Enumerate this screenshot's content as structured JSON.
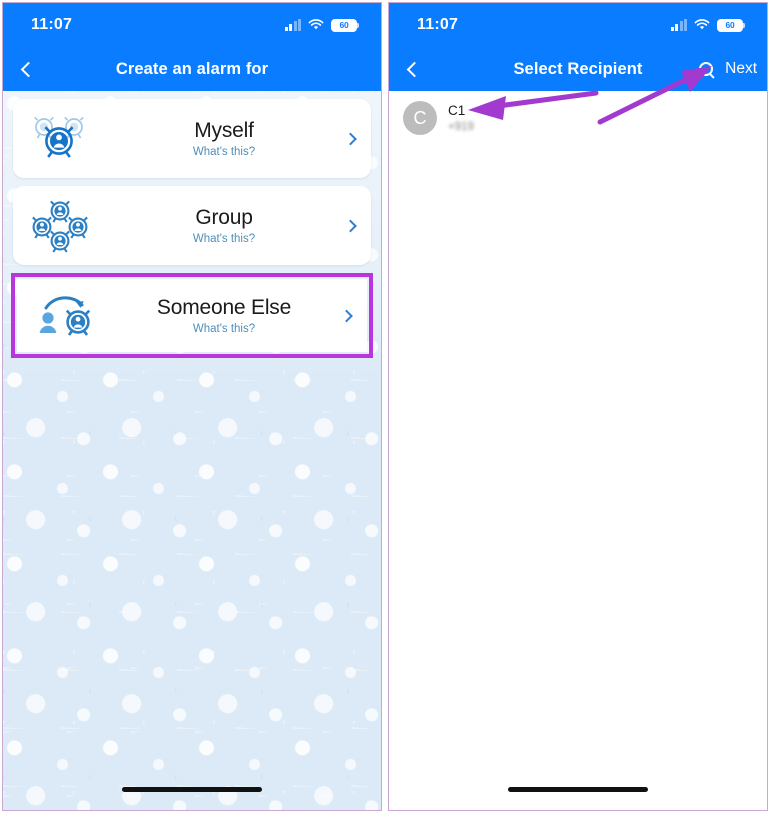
{
  "meta": {
    "accent_blue": "#0a7cff",
    "highlight_purple": "#b935dd",
    "panel_bg_left": "#dceaf7",
    "arrow_color": "#a23ad0"
  },
  "left_screen": {
    "status": {
      "time": "11:07",
      "signal_icon": "cellular-signal-icon",
      "wifi_icon": "wifi-icon",
      "battery_icon": "battery-icon",
      "battery_level": "60"
    },
    "nav": {
      "back_icon": "chevron-left-icon",
      "title": "Create an alarm for"
    },
    "options": [
      {
        "title": "Myself",
        "subtitle": "What's this?",
        "icon": "alarm-clock-person-icon",
        "chevron": "chevron-right-icon",
        "highlighted": false
      },
      {
        "title": "Group",
        "subtitle": "What's this?",
        "icon": "alarm-clock-group-icon",
        "chevron": "chevron-right-icon",
        "highlighted": false
      },
      {
        "title": "Someone Else",
        "subtitle": "What's this?",
        "icon": "person-arrow-alarm-icon",
        "chevron": "chevron-right-icon",
        "highlighted": true
      }
    ]
  },
  "right_screen": {
    "status": {
      "time": "11:07",
      "signal_icon": "cellular-signal-icon",
      "wifi_icon": "wifi-icon",
      "battery_icon": "battery-icon",
      "battery_level": "60"
    },
    "nav": {
      "back_icon": "chevron-left-icon",
      "title": "Select Recipient",
      "search_icon": "search-icon",
      "next_label": "Next"
    },
    "contacts": [
      {
        "avatar_initial": "C",
        "name": "C1",
        "phone": "+919"
      }
    ]
  },
  "annotations": [
    {
      "name": "arrow-to-contact",
      "points_at": "C1 contact row"
    },
    {
      "name": "arrow-to-next",
      "points_at": "Next button"
    }
  ]
}
